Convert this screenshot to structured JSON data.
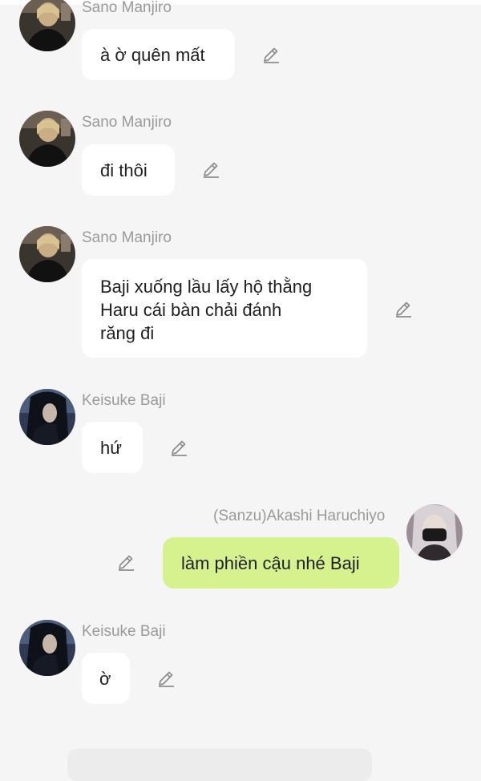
{
  "colors": {
    "background": "#f5f5f5",
    "bubble_other": "#ffffff",
    "bubble_self": "#d6f28f",
    "sender_name": "#9a9a9a",
    "icon": "#8c8c8c"
  },
  "messages": [
    {
      "sender": "Sano Manjiro",
      "text": "à ờ quên mất",
      "outgoing": false,
      "avatar_icon": "sano-avatar",
      "action_icon": "pencil-edit-icon"
    },
    {
      "sender": "Sano Manjiro",
      "text": "đi thôi",
      "outgoing": false,
      "avatar_icon": "sano-avatar",
      "action_icon": "pencil-edit-icon"
    },
    {
      "sender": "Sano Manjiro",
      "text_lines": [
        "Baji xuống lầu lấy hộ thằng",
        "Haru cái bàn chải đánh",
        "răng đi"
      ],
      "outgoing": false,
      "avatar_icon": "sano-avatar",
      "action_icon": "pencil-edit-icon"
    },
    {
      "sender": "Keisuke Baji",
      "text": "hứ",
      "outgoing": false,
      "avatar_icon": "baji-avatar",
      "action_icon": "pencil-edit-icon"
    },
    {
      "sender": "(Sanzu)Akashi Haruchiyo",
      "text": "làm phiền cậu nhé Baji",
      "outgoing": true,
      "avatar_icon": "haruchiyo-avatar",
      "action_icon": "pencil-edit-icon"
    },
    {
      "sender": "Keisuke Baji",
      "text": "ờ",
      "outgoing": false,
      "avatar_icon": "baji-avatar",
      "action_icon": "pencil-edit-icon"
    }
  ]
}
